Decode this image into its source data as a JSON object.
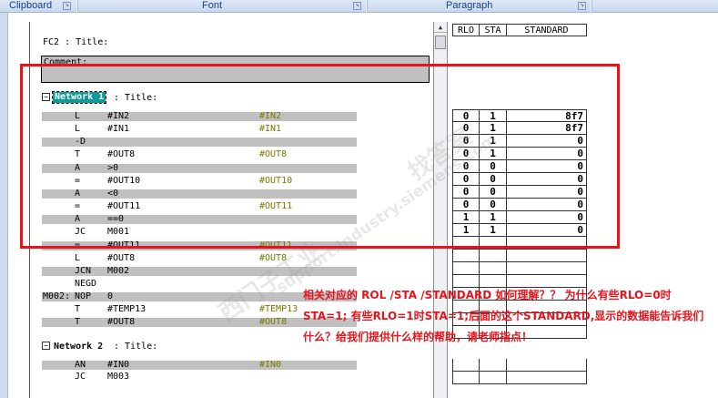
{
  "ribbon": {
    "groups": [
      "Clipboard",
      "Font",
      "Paragraph"
    ]
  },
  "block": {
    "header": "FC2 : Title:",
    "comment": "Comment:",
    "network1": {
      "label": "Network 1",
      "title": ": Title:"
    },
    "network2": {
      "label": "Network 2",
      "title": ": Title:"
    }
  },
  "code": [
    {
      "label": "",
      "op": "L",
      "operand": "#IN2",
      "sym": "#IN2",
      "bg": true
    },
    {
      "label": "",
      "op": "L",
      "operand": "#IN1",
      "sym": "#IN1",
      "bg": false
    },
    {
      "label": "",
      "op": "-D",
      "operand": "",
      "sym": "",
      "bg": true
    },
    {
      "label": "",
      "op": "T",
      "operand": "#OUT8",
      "sym": "#OUT8",
      "bg": false
    },
    {
      "label": "",
      "op": "A",
      "operand": ">0",
      "sym": "",
      "bg": true
    },
    {
      "label": "",
      "op": "=",
      "operand": "#OUT10",
      "sym": "#OUT10",
      "bg": false
    },
    {
      "label": "",
      "op": "A",
      "operand": "<0",
      "sym": "",
      "bg": true
    },
    {
      "label": "",
      "op": "=",
      "operand": "#OUT11",
      "sym": "#OUT11",
      "bg": false
    },
    {
      "label": "",
      "op": "A",
      "operand": "==0",
      "sym": "",
      "bg": true
    },
    {
      "label": "",
      "op": "JC",
      "operand": "M001",
      "sym": "",
      "bg": false
    },
    {
      "label": "",
      "op": "=",
      "operand": "#OUT11",
      "sym": "#OUT11",
      "bg": true
    },
    {
      "label": "",
      "op": "L",
      "operand": "#OUT8",
      "sym": "#OUT8",
      "bg": false
    },
    {
      "label": "",
      "op": "JCN",
      "operand": "M002",
      "sym": "",
      "bg": true
    },
    {
      "label": "",
      "op": "NEGD",
      "operand": "",
      "sym": "",
      "bg": false
    },
    {
      "label": "M002:",
      "op": "NOP",
      "operand": "0",
      "sym": "",
      "bg": true
    },
    {
      "label": "",
      "op": "T",
      "operand": "#TEMP13",
      "sym": "#TEMP13",
      "bg": false
    },
    {
      "label": "",
      "op": "T",
      "operand": "#OUT8",
      "sym": "#OUT8",
      "bg": true
    }
  ],
  "code2": [
    {
      "op": "AN",
      "operand": "#IN0",
      "sym": "#IN0",
      "bg": true
    },
    {
      "op": "JC",
      "operand": "M003",
      "sym": "",
      "bg": false
    }
  ],
  "status_table": {
    "headers": [
      "RLO",
      "STA",
      "STANDARD"
    ],
    "rows": [
      [
        "0",
        "1",
        "8f7"
      ],
      [
        "0",
        "1",
        "8f7"
      ],
      [
        "0",
        "1",
        "0"
      ],
      [
        "0",
        "1",
        "0"
      ],
      [
        "0",
        "0",
        "0"
      ],
      [
        "0",
        "0",
        "0"
      ],
      [
        "0",
        "0",
        "0"
      ],
      [
        "0",
        "0",
        "0"
      ],
      [
        "1",
        "1",
        "0"
      ],
      [
        "1",
        "1",
        "0"
      ]
    ]
  },
  "question": "相关对应的 ROL /STA /STANDARD 如何理解？？ 为什么有些RLO=0时STA=1; 有些RLO=1时STA=1;后面的这个STANDARD,显示的数据能告诉我们什么？给我们提供什么样的帮助，请老师指点！",
  "watermarks": [
    "西门子工业",
    "support.industry.siemens.com",
    "找答案"
  ]
}
